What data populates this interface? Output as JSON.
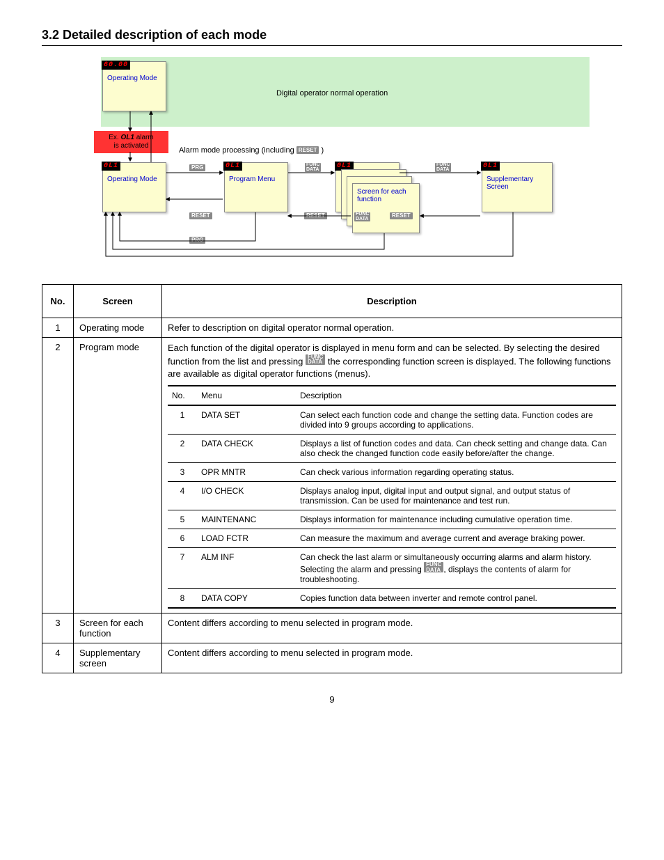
{
  "header": "3.2  Detailed description of each mode",
  "diagram": {
    "topCaption": "Digital operator normal operation",
    "alarmBox": "Ex. OL1 alarm\nis activated",
    "alarmCaption": "Alarm mode processing (including ",
    "alarmCaptionKey": "RESET",
    "alarmCaptionEnd": " )",
    "lcd6000": "60.00",
    "lcdOL": "0L1",
    "labels": {
      "operatingMode": "Operating Mode",
      "programMenu": "Program Menu",
      "screenEach": "Screen for each\nfunction",
      "supplementary": "Supplementary\nScreen"
    },
    "keys": {
      "prg": "PRG",
      "reset": "RESET",
      "func": "FUNC\nDATA"
    }
  },
  "outerTable": {
    "headers": {
      "no": "No.",
      "screen": "Screen",
      "desc": "Description"
    },
    "rows": [
      {
        "no": "1",
        "screen": "Operating mode",
        "desc": "Refer to description on digital operator normal operation."
      },
      {
        "no": "2",
        "screen": "Program mode",
        "descIntro": "Each function of the digital operator is displayed in menu form and can be selected.  By selecting the desired function from the list and pressing ",
        "descIntroKey": "FUNC DATA",
        "descIntroAfter": "  the corresponding function screen is displayed.  The following functions are available as digital operator functions (menus).",
        "menuHeaders": {
          "no": "No.",
          "name": "Menu",
          "desc": "Description"
        },
        "menu": [
          {
            "no": "1",
            "name": "DATA SET",
            "desc": "Can select each function code and change the setting data.  Function codes are divided into 9 groups according to applications."
          },
          {
            "no": "2",
            "name": "DATA CHECK",
            "desc": "Displays a list of function codes and data.  Can check setting and change data.  Can also check the changed function code easily before/after the change."
          },
          {
            "no": "3",
            "name": "OPR MNTR",
            "desc": "Can check various information regarding operating status."
          },
          {
            "no": "4",
            "name": "I/O CHECK",
            "desc": "Displays analog input, digital input and output signal, and output status of transmission.  Can be used for maintenance and test run."
          },
          {
            "no": "5",
            "name": "MAINTENANC",
            "desc": "Displays information for maintenance including cumulative operation time."
          },
          {
            "no": "6",
            "name": "LOAD FCTR",
            "desc": "Can measure the maximum and average current and average braking power."
          },
          {
            "no": "7",
            "name": "ALM INF",
            "descPre": "Can check the last alarm or simultaneously occurring alarms and alarm history.  Selecting the alarm and pressing  ",
            "descKey": "FUNC DATA",
            "descPost": ", displays the contents of alarm for troubleshooting."
          },
          {
            "no": "8",
            "name": "DATA COPY",
            "desc": "Copies function data between inverter and remote control panel."
          }
        ]
      },
      {
        "no": "3",
        "screen": "Screen for each function",
        "desc": "Content differs according to menu selected in program mode."
      },
      {
        "no": "4",
        "screen": "Supplementary screen",
        "desc": "Content differs according to menu selected in program mode."
      }
    ]
  },
  "page": "9"
}
